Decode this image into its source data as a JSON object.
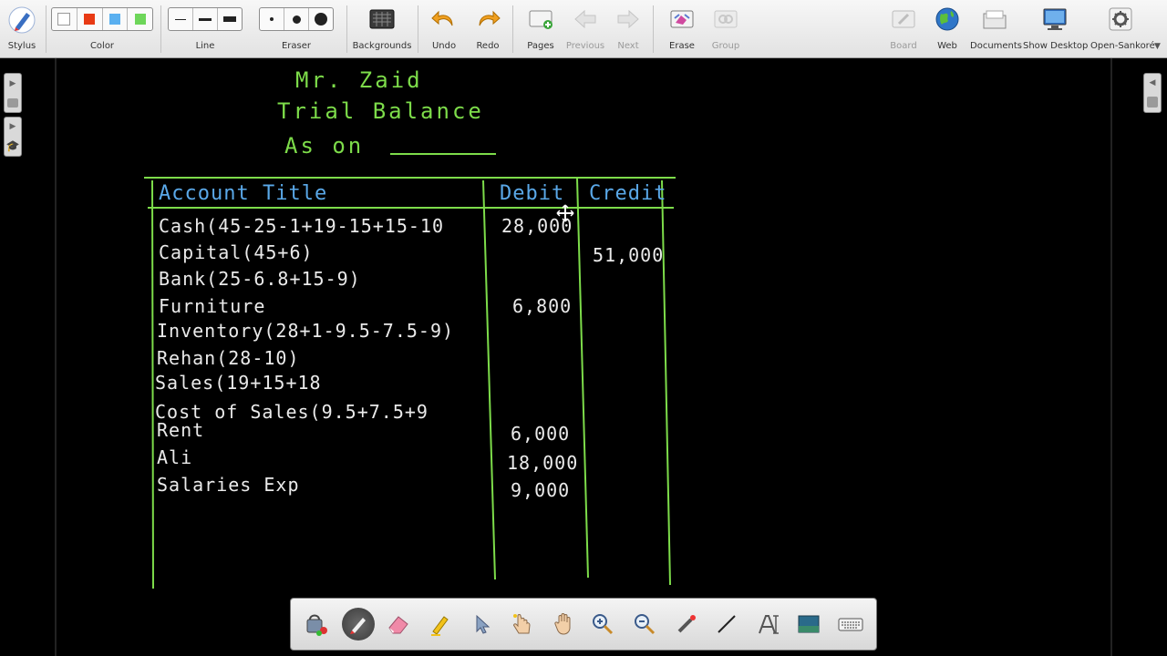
{
  "toolbar": {
    "stylus": "Stylus",
    "color": "Color",
    "line": "Line",
    "eraser": "Eraser",
    "backgrounds": "Backgrounds",
    "undo": "Undo",
    "redo": "Redo",
    "pages": "Pages",
    "previous": "Previous",
    "next": "Next",
    "erase": "Erase",
    "group": "Group",
    "board": "Board",
    "web": "Web",
    "documents": "Documents",
    "show_desktop": "Show Desktop",
    "open_sankore": "Open-Sankoré",
    "colors": [
      "#ffffff",
      "#e83a14",
      "#5ab0f0",
      "#6ed65a"
    ]
  },
  "board": {
    "title_name": "Mr. Zaid",
    "title_doc": "Trial Balance",
    "title_date": "As on",
    "headers": {
      "account": "Account Title",
      "debit": "Debit",
      "credit": "Credit"
    },
    "rows": [
      {
        "account": "Cash(45-25-1+19-15+15-10",
        "debit": "28,000",
        "credit": ""
      },
      {
        "account": "Capital(45+6)",
        "debit": "",
        "credit": "51,000"
      },
      {
        "account": "Bank(25-6.8+15-9)",
        "debit": "",
        "credit": ""
      },
      {
        "account": "Furniture",
        "debit": "6,800",
        "credit": ""
      },
      {
        "account": "Inventory(28+1-9.5-7.5-9)",
        "debit": "",
        "credit": ""
      },
      {
        "account": "Rehan(28-10)",
        "debit": "",
        "credit": ""
      },
      {
        "account": "Sales(19+15+18",
        "debit": "",
        "credit": ""
      },
      {
        "account": "Cost of Sales(9.5+7.5+9",
        "debit": "",
        "credit": ""
      },
      {
        "account": "Rent",
        "debit": "6,000",
        "credit": ""
      },
      {
        "account": "Ali",
        "debit": "18,000",
        "credit": ""
      },
      {
        "account": "Salaries Exp",
        "debit": "9,000",
        "credit": ""
      }
    ],
    "colors": {
      "ink_green": "#7ddc4a",
      "ink_blue": "#5aa8e8",
      "ink_white": "#eaeaea"
    }
  }
}
